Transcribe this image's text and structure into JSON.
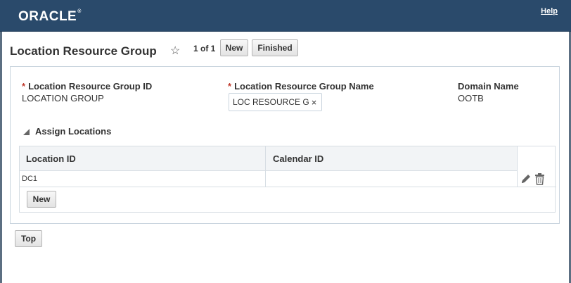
{
  "header": {
    "logo": "ORACLE",
    "help_link": "Help"
  },
  "titlebar": {
    "title": "Location Resource Group",
    "favorite_icon": "star-icon",
    "pager": "1 of 1",
    "new_button": "New",
    "finished_button": "Finished"
  },
  "form": {
    "id_label": "Location Resource Group ID",
    "id_value": "LOCATION GROUP",
    "name_label": "Location Resource Group Name",
    "name_value": "LOC RESOURCE G",
    "name_clear": "×",
    "domain_label": "Domain Name",
    "domain_value": "OOTB",
    "required_marker": "*"
  },
  "assign_locations": {
    "section_title": "Assign Locations",
    "columns": [
      "Location ID",
      "Calendar ID"
    ],
    "rows": [
      {
        "location_id": "DC1",
        "calendar_id": ""
      }
    ],
    "row_icons": [
      "edit-icon",
      "delete-icon"
    ],
    "new_button": "New"
  },
  "footer": {
    "top_button": "Top"
  },
  "colors": {
    "header_bg": "#2a4a6b",
    "required": "#c0392b",
    "panel_border": "#c9d4de"
  }
}
